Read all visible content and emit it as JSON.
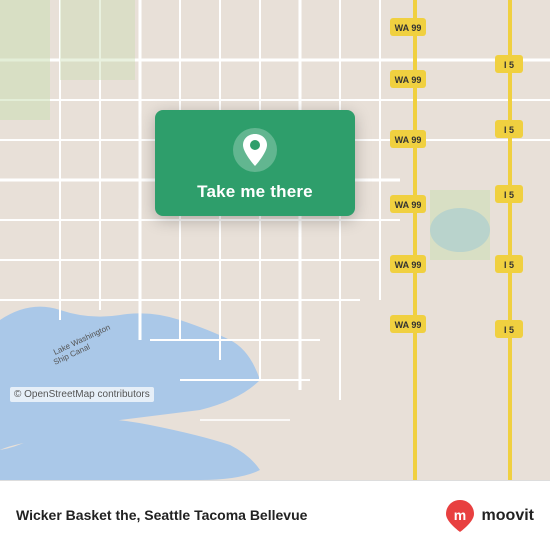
{
  "map": {
    "background_color": "#e8e0d8",
    "copyright": "© OpenStreetMap contributors"
  },
  "card": {
    "label": "Take me there",
    "bg_color": "#2e9e6b"
  },
  "bottom_bar": {
    "location_name": "Wicker Basket the, Seattle Tacoma Bellevue"
  },
  "moovit": {
    "text": "moovit"
  }
}
